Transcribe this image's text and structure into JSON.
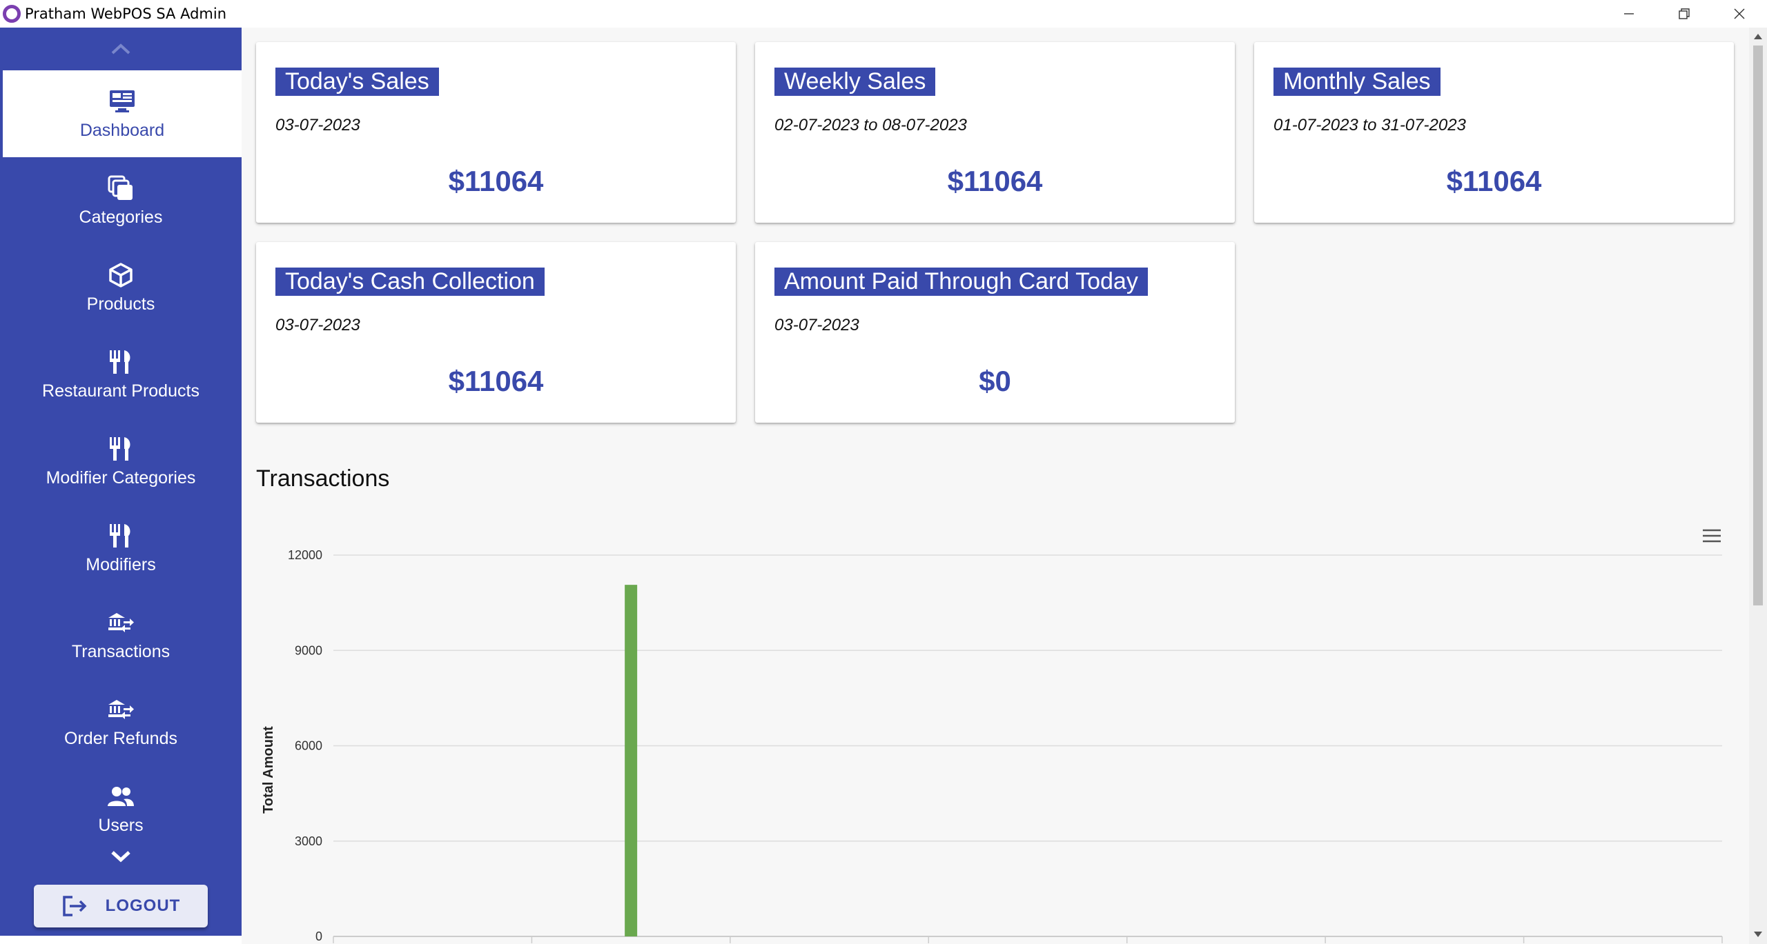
{
  "window": {
    "title": "Pratham WebPOS SA Admin"
  },
  "sidebar": {
    "items": [
      {
        "label": "Dashboard",
        "icon": "monitor-dashboard-icon",
        "active": true
      },
      {
        "label": "Categories",
        "icon": "layers-icon"
      },
      {
        "label": "Products",
        "icon": "cube-icon"
      },
      {
        "label": "Restaurant Products",
        "icon": "fork-knife-icon"
      },
      {
        "label": "Modifier Categories",
        "icon": "fork-knife-icon"
      },
      {
        "label": "Modifiers",
        "icon": "fork-knife-icon"
      },
      {
        "label": "Transactions",
        "icon": "bank-transfer-icon"
      },
      {
        "label": "Order Refunds",
        "icon": "bank-transfer-icon"
      },
      {
        "label": "Users",
        "icon": "users-icon"
      }
    ],
    "logout_label": "LOGOUT"
  },
  "cards": [
    {
      "title": "Today's Sales",
      "date": "03-07-2023",
      "value": "$11064"
    },
    {
      "title": "Weekly Sales",
      "date": "02-07-2023 to 08-07-2023",
      "value": "$11064"
    },
    {
      "title": "Monthly Sales",
      "date": "01-07-2023 to 31-07-2023",
      "value": "$11064"
    },
    {
      "title": "Today's Cash Collection",
      "date": "03-07-2023",
      "value": "$11064"
    },
    {
      "title": "Amount Paid Through Card Today",
      "date": "03-07-2023",
      "value": "$0"
    }
  ],
  "transactions": {
    "title": "Transactions"
  },
  "colors": {
    "primary": "#3949ab",
    "bar": "#6aa84f",
    "background": "#f7f7f7"
  },
  "chart_data": {
    "type": "bar",
    "title": "",
    "xlabel": "",
    "ylabel": "Total Amount",
    "ylim": [
      0,
      12000
    ],
    "yticks": [
      0,
      3000,
      6000,
      9000,
      12000
    ],
    "categories": [
      "",
      "",
      "",
      "",
      "",
      "",
      ""
    ],
    "values": [
      0,
      11064,
      0,
      0,
      0,
      0,
      0
    ],
    "grid": true
  }
}
